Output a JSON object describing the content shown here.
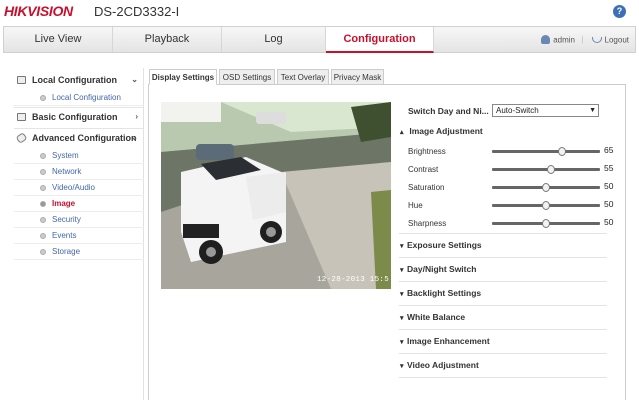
{
  "header": {
    "brand": "HIKVISION",
    "model": "DS-2CD3332-I",
    "help_icon": "question-icon",
    "help_text": "?"
  },
  "nav": {
    "tabs": [
      {
        "label": "Live View"
      },
      {
        "label": "Playback"
      },
      {
        "label": "Log"
      },
      {
        "label": "Configuration"
      }
    ],
    "active_tab": "Configuration",
    "user": "admin",
    "separator": "|",
    "logout": "Logout"
  },
  "sidebar": {
    "local": {
      "label": "Local Configuration",
      "chevron": "⌄",
      "items": [
        "Local Configuration"
      ]
    },
    "basic": {
      "label": "Basic Configuration",
      "chevron": "›"
    },
    "advanced": {
      "label": "Advanced Configuration",
      "chevron": "⌄",
      "items": [
        "System",
        "Network",
        "Video/Audio",
        "Image",
        "Security",
        "Events",
        "Storage"
      ],
      "active_item": "Image"
    }
  },
  "content_tabs": [
    "Display Settings",
    "OSD Settings",
    "Text Overlay",
    "Privacy Mask"
  ],
  "active_content_tab": "Display Settings",
  "video": {
    "timestamp": "12-28-2013 15:5"
  },
  "settings": {
    "switch_label": "Switch Day and Ni...",
    "switch_value": "Auto-Switch",
    "image_adjustment": {
      "title": "Image Adjustment",
      "caret": "▴",
      "rows": [
        {
          "label": "Brightness",
          "value": "65"
        },
        {
          "label": "Contrast",
          "value": "55"
        },
        {
          "label": "Saturation",
          "value": "50"
        },
        {
          "label": "Hue",
          "value": "50"
        },
        {
          "label": "Sharpness",
          "value": "50"
        }
      ]
    },
    "collapsed_caret": "▾",
    "groups": [
      "Exposure Settings",
      "Day/Night Switch",
      "Backlight Settings",
      "White Balance",
      "Image Enhancement",
      "Video Adjustment"
    ]
  },
  "colors": {
    "brand_red": "#c8102e",
    "link_blue": "#4466aa",
    "help_blue": "#3d6fb8"
  }
}
